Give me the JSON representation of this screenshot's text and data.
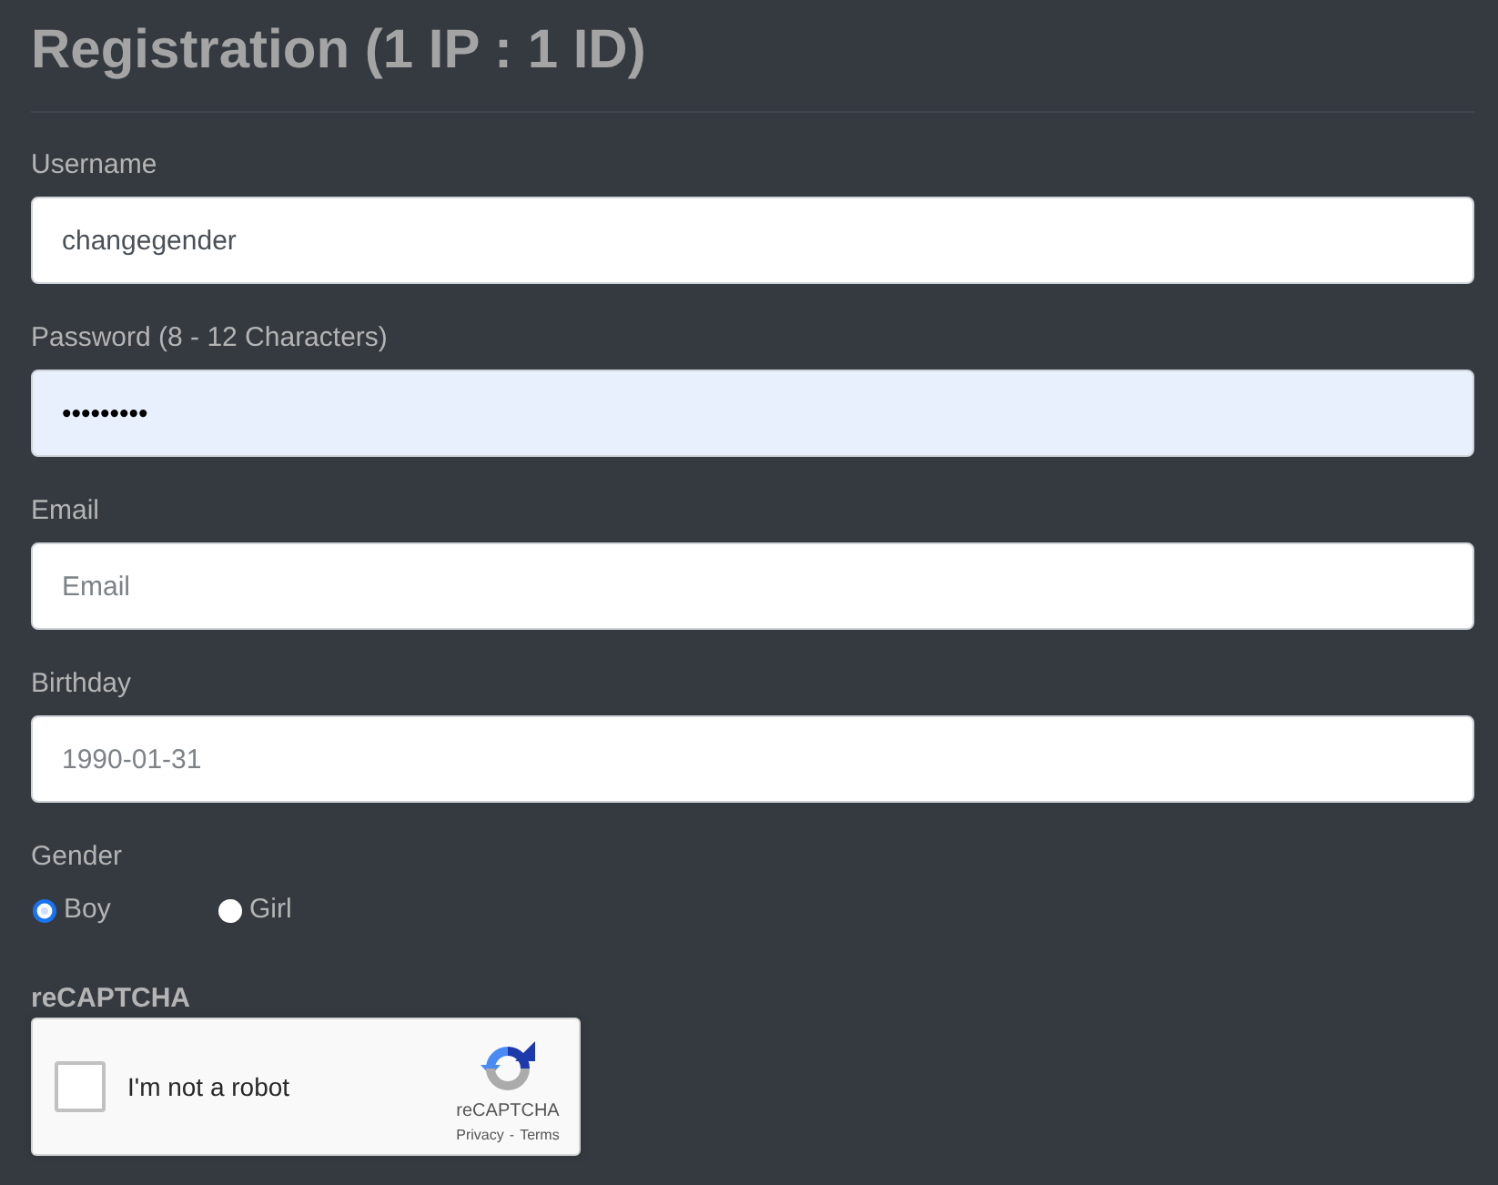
{
  "page": {
    "title": "Registration (1 IP : 1 ID)"
  },
  "fields": [
    {
      "label": "Username",
      "value": "changegender",
      "autofilled": false
    },
    {
      "label": "Password (8 - 12 Characters)",
      "value": "•••••••••",
      "autofilled": true
    },
    {
      "label": "Email",
      "placeholder": "Email",
      "autofilled": false
    },
    {
      "label": "Birthday",
      "placeholder": "1990-01-31",
      "autofilled": false
    }
  ],
  "gender": {
    "label": "Gender",
    "options": [
      {
        "label": "Boy",
        "selected": true
      },
      {
        "label": "Girl",
        "selected": false
      }
    ]
  },
  "captcha": {
    "label": "reCAPTCHA",
    "checkbox_label": "I'm not a robot",
    "checked": false,
    "brand": "reCAPTCHA",
    "links": [
      "Privacy",
      "Terms"
    ],
    "separator": "-"
  }
}
